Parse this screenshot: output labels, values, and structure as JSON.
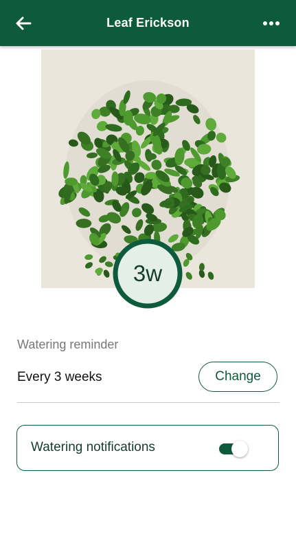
{
  "appbar": {
    "title": "Leaf Erickson",
    "back_icon": "arrow-left-icon",
    "more_icon": "more-horizontal-icon"
  },
  "plant": {
    "photo_description_icon": "plant-photo",
    "interval_badge": "3w",
    "interval_progress_fraction": 1.0
  },
  "watering": {
    "section_label": "Watering reminder",
    "frequency_text": "Every 3 weeks",
    "change_label": "Change"
  },
  "notifications": {
    "label": "Watering notifications",
    "enabled": true
  },
  "colors": {
    "brand_green": "#0d5a3c",
    "ring_fill": "#e4efea"
  }
}
